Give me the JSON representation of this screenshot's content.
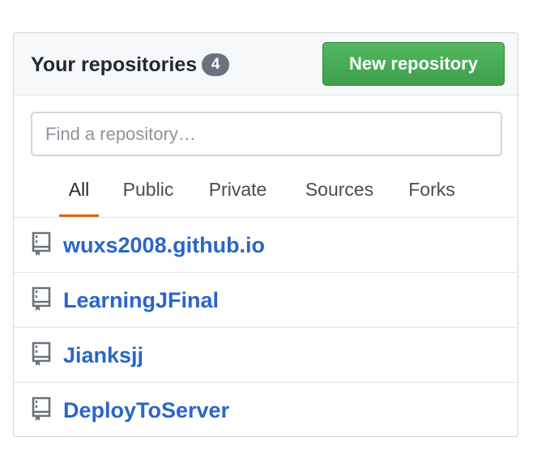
{
  "header": {
    "title": "Your repositories",
    "count": "4",
    "new_button_label": "New repository"
  },
  "search": {
    "placeholder": "Find a repository…",
    "value": ""
  },
  "tabs": [
    {
      "label": "All",
      "selected": true
    },
    {
      "label": "Public",
      "selected": false
    },
    {
      "label": "Private",
      "selected": false
    },
    {
      "label": "Sources",
      "selected": false
    },
    {
      "label": "Forks",
      "selected": false
    }
  ],
  "repositories": [
    {
      "name": "wuxs2008.github.io",
      "icon": "repo-icon"
    },
    {
      "name": "LearningJFinal",
      "icon": "repo-icon"
    },
    {
      "name": "Jianksjj",
      "icon": "repo-icon"
    },
    {
      "name": "DeployToServer",
      "icon": "repo-icon"
    }
  ],
  "colors": {
    "accent_button": "#3f9f4c",
    "link": "#2a65c9",
    "selected_tab_underline": "#e36209",
    "badge": "#6a737d"
  }
}
